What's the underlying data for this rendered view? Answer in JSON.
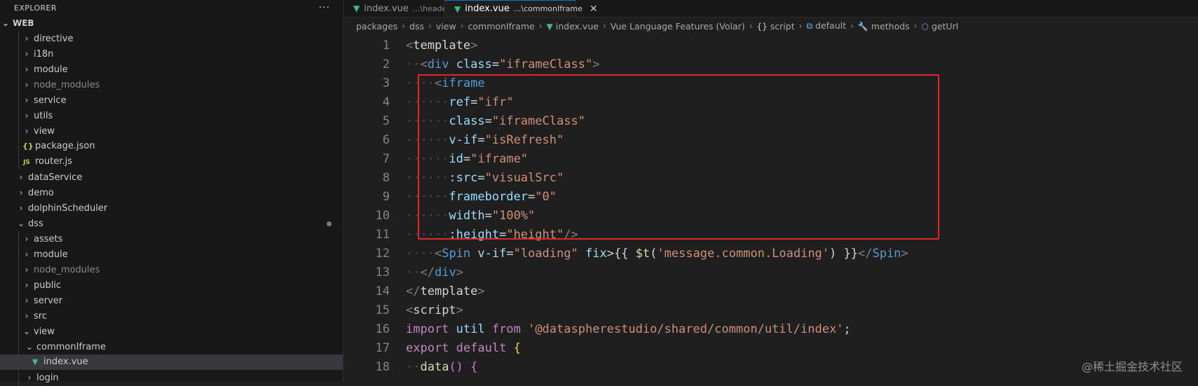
{
  "explorer": {
    "title": "EXPLORER",
    "more": "···",
    "root": "WEB",
    "items": [
      {
        "label": "directive",
        "icon": "chevron-right",
        "depth": 2,
        "kind": "folder",
        "dim": false
      },
      {
        "label": "i18n",
        "icon": "chevron-right",
        "depth": 2,
        "kind": "folder",
        "dim": false
      },
      {
        "label": "module",
        "icon": "chevron-right",
        "depth": 2,
        "kind": "folder",
        "dim": false
      },
      {
        "label": "node_modules",
        "icon": "chevron-right",
        "depth": 2,
        "kind": "folder",
        "dim": true
      },
      {
        "label": "service",
        "icon": "chevron-right",
        "depth": 2,
        "kind": "folder",
        "dim": false
      },
      {
        "label": "utils",
        "icon": "chevron-right",
        "depth": 2,
        "kind": "folder",
        "dim": false
      },
      {
        "label": "view",
        "icon": "chevron-right",
        "depth": 2,
        "kind": "folder",
        "dim": false
      },
      {
        "label": "package.json",
        "icon": "{}",
        "depth": 2,
        "kind": "json",
        "dim": false
      },
      {
        "label": "router.js",
        "icon": "JS",
        "depth": 2,
        "kind": "js",
        "dim": false
      },
      {
        "label": "dataService",
        "icon": "chevron-right",
        "depth": 1,
        "kind": "folder",
        "dim": false
      },
      {
        "label": "demo",
        "icon": "chevron-right",
        "depth": 1,
        "kind": "folder",
        "dim": false
      },
      {
        "label": "dolphinScheduler",
        "icon": "chevron-right",
        "depth": 1,
        "kind": "folder",
        "dim": false
      },
      {
        "label": "dss",
        "icon": "chevron-down",
        "depth": 1,
        "kind": "folder-open",
        "dim": false,
        "modified": true
      },
      {
        "label": "assets",
        "icon": "chevron-right",
        "depth": 2,
        "kind": "folder",
        "dim": false
      },
      {
        "label": "module",
        "icon": "chevron-right",
        "depth": 2,
        "kind": "folder",
        "dim": false
      },
      {
        "label": "node_modules",
        "icon": "chevron-right",
        "depth": 2,
        "kind": "folder",
        "dim": true
      },
      {
        "label": "public",
        "icon": "chevron-right",
        "depth": 2,
        "kind": "folder",
        "dim": false
      },
      {
        "label": "server",
        "icon": "chevron-right",
        "depth": 2,
        "kind": "folder",
        "dim": false
      },
      {
        "label": "src",
        "icon": "chevron-right",
        "depth": 2,
        "kind": "folder",
        "dim": false
      },
      {
        "label": "view",
        "icon": "chevron-down",
        "depth": 2,
        "kind": "folder-open",
        "dim": false
      },
      {
        "label": "commonIframe",
        "icon": "chevron-down",
        "depth": 3,
        "kind": "folder-open",
        "dim": false
      },
      {
        "label": "index.vue",
        "icon": "vue",
        "depth": 4,
        "kind": "vue",
        "dim": false,
        "selected": true
      },
      {
        "label": "login",
        "icon": "chevron-right",
        "depth": 3,
        "kind": "folder",
        "dim": false
      }
    ]
  },
  "tabs": [
    {
      "label": "index.vue",
      "desc": "...\\header",
      "active": false
    },
    {
      "label": "index.vue",
      "desc": "...\\commonIframe",
      "active": true,
      "close": "✕"
    }
  ],
  "breadcrumb": [
    {
      "label": "packages",
      "icon": ""
    },
    {
      "label": "dss",
      "icon": ""
    },
    {
      "label": "view",
      "icon": ""
    },
    {
      "label": "commonIframe",
      "icon": ""
    },
    {
      "label": "index.vue",
      "icon": "vue"
    },
    {
      "label": "Vue Language Features (Volar)",
      "icon": ""
    },
    {
      "label": "script",
      "icon": "{}"
    },
    {
      "label": "default",
      "icon": "module"
    },
    {
      "label": "methods",
      "icon": "wrench"
    },
    {
      "label": "getUrl",
      "icon": "cube"
    }
  ],
  "code": {
    "line_numbers": [
      "1",
      "2",
      "3",
      "4",
      "5",
      "6",
      "7",
      "8",
      "9",
      "10",
      "11",
      "12",
      "13",
      "14",
      "15",
      "16",
      "17",
      "18"
    ],
    "lines": [
      [
        [
          "bracket",
          "<"
        ],
        [
          "plain",
          "template"
        ],
        [
          "bracket",
          ">"
        ]
      ],
      [
        [
          "ws",
          "  "
        ],
        [
          "bracket",
          "<"
        ],
        [
          "tag",
          "div"
        ],
        [
          "plain",
          " "
        ],
        [
          "attr",
          "class"
        ],
        [
          "plain",
          "="
        ],
        [
          "str",
          "\"iframeClass\""
        ],
        [
          "bracket",
          ">"
        ]
      ],
      [
        [
          "ws",
          "    "
        ],
        [
          "bracket",
          "<"
        ],
        [
          "tag",
          "iframe"
        ]
      ],
      [
        [
          "ws",
          "      "
        ],
        [
          "attr",
          "ref"
        ],
        [
          "plain",
          "="
        ],
        [
          "str",
          "\"ifr\""
        ]
      ],
      [
        [
          "ws",
          "      "
        ],
        [
          "attr",
          "class"
        ],
        [
          "plain",
          "="
        ],
        [
          "str",
          "\"iframeClass\""
        ]
      ],
      [
        [
          "ws",
          "      "
        ],
        [
          "attr",
          "v-if"
        ],
        [
          "plain",
          "="
        ],
        [
          "str",
          "\"isRefresh\""
        ]
      ],
      [
        [
          "ws",
          "      "
        ],
        [
          "attr",
          "id"
        ],
        [
          "plain",
          "="
        ],
        [
          "str",
          "\"iframe\""
        ]
      ],
      [
        [
          "ws",
          "      "
        ],
        [
          "attr",
          ":src"
        ],
        [
          "plain",
          "="
        ],
        [
          "str",
          "\"visualSrc\""
        ]
      ],
      [
        [
          "ws",
          "      "
        ],
        [
          "attr",
          "frameborder"
        ],
        [
          "plain",
          "="
        ],
        [
          "str",
          "\"0\""
        ]
      ],
      [
        [
          "ws",
          "      "
        ],
        [
          "attr",
          "width"
        ],
        [
          "plain",
          "="
        ],
        [
          "str",
          "\"100%\""
        ]
      ],
      [
        [
          "ws",
          "      "
        ],
        [
          "attr",
          ":height"
        ],
        [
          "plain",
          "="
        ],
        [
          "str",
          "\"height\""
        ],
        [
          "bracket",
          "/>"
        ]
      ],
      [
        [
          "ws",
          "    "
        ],
        [
          "bracket",
          "<"
        ],
        [
          "tag",
          "Spin"
        ],
        [
          "plain",
          " "
        ],
        [
          "attr",
          "v-if"
        ],
        [
          "plain",
          "="
        ],
        [
          "str",
          "\"loading\""
        ],
        [
          "plain",
          " "
        ],
        [
          "attr",
          "fix"
        ],
        [
          "plain",
          ">{{ "
        ],
        [
          "fn",
          "$t"
        ],
        [
          "plain",
          "("
        ],
        [
          "str",
          "'message.common.Loading'"
        ],
        [
          "plain",
          ") }}"
        ],
        [
          "bracket",
          "</"
        ],
        [
          "tag",
          "Spin"
        ],
        [
          "bracket",
          ">"
        ]
      ],
      [
        [
          "ws",
          "  "
        ],
        [
          "bracket",
          "</"
        ],
        [
          "tag",
          "div"
        ],
        [
          "bracket",
          ">"
        ]
      ],
      [
        [
          "bracket",
          "</"
        ],
        [
          "plain",
          "template"
        ],
        [
          "bracket",
          ">"
        ]
      ],
      [
        [
          "bracket",
          "<"
        ],
        [
          "plain",
          "script"
        ],
        [
          "bracket",
          ">"
        ]
      ],
      [
        [
          "kw",
          "import"
        ],
        [
          "plain",
          " "
        ],
        [
          "var",
          "util"
        ],
        [
          "plain",
          " "
        ],
        [
          "kw",
          "from"
        ],
        [
          "plain",
          " "
        ],
        [
          "str",
          "'@dataspherestudio/shared/common/util/index'"
        ],
        [
          "plain",
          ";"
        ]
      ],
      [
        [
          "kw",
          "export"
        ],
        [
          "plain",
          " "
        ],
        [
          "kw",
          "default"
        ],
        [
          "plain",
          " "
        ],
        [
          "brace",
          "{"
        ]
      ],
      [
        [
          "ws",
          "  "
        ],
        [
          "fn",
          "data"
        ],
        [
          "brace2",
          "()"
        ],
        [
          "plain",
          " "
        ],
        [
          "brace2",
          "{"
        ]
      ]
    ]
  },
  "watermark": "@稀土掘金技术社区",
  "colors": {
    "highlight_box": "#e0262a",
    "vue_green": "#41b883",
    "active_tab_border": "#0078d4"
  }
}
